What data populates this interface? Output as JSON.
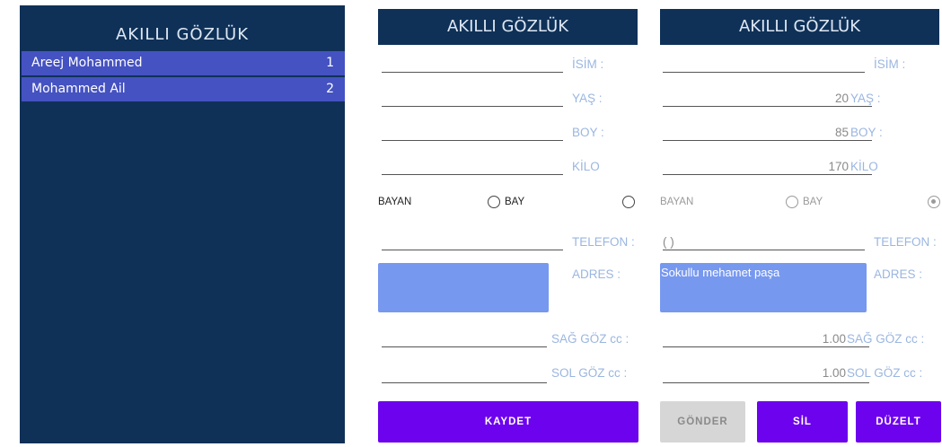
{
  "left": {
    "title": "AKILLI GÖZLÜK",
    "items": [
      {
        "name": "Areej Mohammed",
        "num": "1"
      },
      {
        "name": "Mohammed Ail",
        "num": "2"
      }
    ]
  },
  "form_a": {
    "title": "AKILLI GÖZLÜK",
    "labels": {
      "isim": "İSİM :",
      "yas": "YAŞ :",
      "boy": "BOY :",
      "kilo": "KİLO",
      "telefon": "TELEFON :",
      "adres": "ADRES :",
      "sag": "SAĞ GÖZ cc :",
      "sol": "SOL GÖZ cc :"
    },
    "gender": {
      "bayan": "BAYAN",
      "bay": "BAY"
    },
    "save_button": "KAYDET"
  },
  "form_b": {
    "title": "AKILLI GÖZLÜK",
    "labels": {
      "isim": "İSİM :",
      "yas": "YAŞ :",
      "boy": "BOY :",
      "kilo": "KİLO",
      "telefon": "TELEFON :",
      "adres": "ADRES :",
      "sag": "SAĞ GÖZ cc :",
      "sol": "SOL GÖZ cc :"
    },
    "values": {
      "yas": "20",
      "boy": "85",
      "kilo": "170",
      "telefon": "(      )",
      "adres": "Sokullu mehamet paşa",
      "sag": "1.00",
      "sol": "1.00"
    },
    "gender": {
      "bayan": "BAYAN",
      "bay": "BAY"
    },
    "buttons": {
      "gonder": "GÖNDER",
      "sil": "SİL",
      "duzelt": "DÜZELT"
    }
  }
}
